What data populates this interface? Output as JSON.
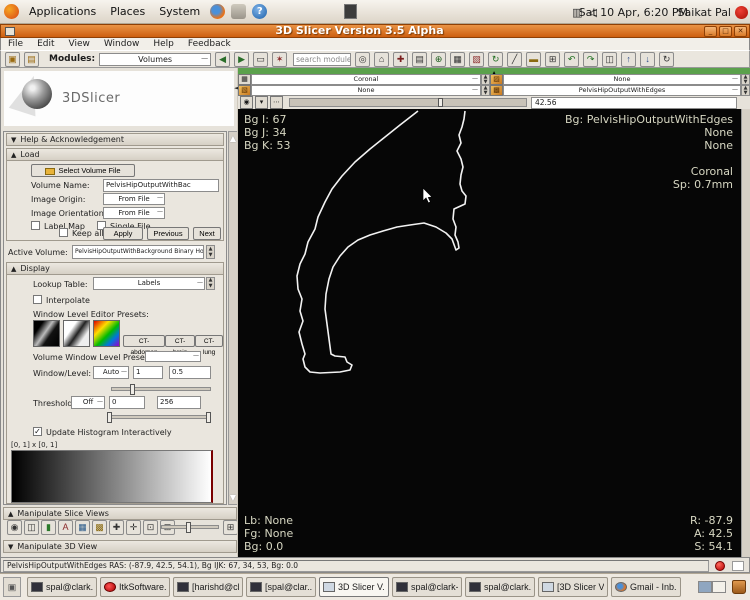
{
  "desktop": {
    "menus": [
      {
        "label": "Applications"
      },
      {
        "label": "Places"
      },
      {
        "label": "System"
      }
    ],
    "clock": "Sat 10 Apr,  6:20 PM",
    "user": "Saikat Pal"
  },
  "window": {
    "title": "3D Slicer Version 3.5 Alpha",
    "minimize": "_",
    "maximize": "□",
    "close": "✕"
  },
  "menubar": {
    "items": [
      {
        "label": "File"
      },
      {
        "label": "Edit"
      },
      {
        "label": "View"
      },
      {
        "label": "Window"
      },
      {
        "label": "Help"
      },
      {
        "label": "Feedback"
      }
    ]
  },
  "toolbar": {
    "load_scene_glyph": "▣",
    "save_scene_glyph": "▤",
    "modules_label": "Modules:",
    "module_value": "Volumes",
    "prev_glyph": "◀",
    "next_glyph": "▶",
    "layout_glyph": "▭",
    "extensions_glyph": "✶",
    "search_value": "search modules",
    "icons": [
      {
        "name": "find-modules-icon",
        "glyph": "◎"
      },
      {
        "name": "home-icon",
        "glyph": "⌂"
      },
      {
        "name": "fiducials-icon",
        "glyph": "✚",
        "color": "#7a1f1f"
      },
      {
        "name": "data-icon",
        "glyph": "▤"
      },
      {
        "name": "crosshair-icon",
        "glyph": "⊕",
        "color": "#1f5e1f"
      },
      {
        "name": "layers-icon",
        "glyph": "▦"
      },
      {
        "name": "editor-icon",
        "glyph": "▧",
        "color": "#8a2a2a"
      },
      {
        "name": "transforms-icon",
        "glyph": "↻",
        "color": "#1f6e1f"
      },
      {
        "name": "slice-tool-icon",
        "glyph": "╱"
      },
      {
        "name": "measurements-icon",
        "glyph": "▬",
        "color": "#8a6a10"
      },
      {
        "name": "colors-icon",
        "glyph": "⊞"
      },
      {
        "name": "undo-icon",
        "glyph": "↶",
        "color": "#1f6e1f"
      },
      {
        "name": "redo-icon",
        "glyph": "↷",
        "color": "#1f6e1f"
      },
      {
        "name": "scene-snapshot-icon",
        "glyph": "◫"
      },
      {
        "name": "pin-up-icon",
        "glyph": "↑",
        "color": "#2a4a8a"
      },
      {
        "name": "pin-down-icon",
        "glyph": "↓",
        "color": "#2a4a8a"
      },
      {
        "name": "screen-capture-icon",
        "glyph": "↻"
      }
    ]
  },
  "left_panel": {
    "logo_text": "3DSlicer",
    "help_header": "Help & Acknowledgement",
    "load": {
      "header": "Load",
      "select_button": "Select Volume File",
      "volume_name_label": "Volume Name:",
      "volume_name_value": "PelvisHipOutputWithBac",
      "image_origin_label": "Image Origin:",
      "image_origin_value": "From File",
      "image_orientation_label": "Image Orientation:",
      "image_orientation_value": "From File",
      "label_map": "Label Map",
      "single_file": "Single File",
      "keep_all": "Keep all",
      "apply": "Apply",
      "previous": "Previous",
      "next": "Next"
    },
    "active_volume_label": "Active Volume:",
    "active_volume_value": "PelvisHipOutputWithBackground Binary HoleFilled",
    "display": {
      "header": "Display",
      "lookup_table_label": "Lookup Table:",
      "lookup_table_value": "Labels",
      "interpolate": "Interpolate",
      "wl_presets_label": "Window Level Editor Presets:",
      "preset_buttons": [
        {
          "label": "CT-abdomen"
        },
        {
          "label": "CT-brain"
        },
        {
          "label": "CT-lung"
        }
      ],
      "volume_wl_presets_label": "Volume Window Level Presets:",
      "window_level_label": "Window/Level:",
      "window_level_mode": "Auto",
      "window_value": "1",
      "level_value": "0.5",
      "threshold_label": "Threshold:",
      "threshold_mode": "Off",
      "threshold_low": "0",
      "threshold_high": "256",
      "update_histogram": "Update Histogram Interactively",
      "histogram_range": "[0, 1] x [0, 1]"
    },
    "slice_views_header": "Manipulate Slice Views",
    "slice_view_icons": [
      {
        "name": "slice-visibility-icon",
        "glyph": "◉"
      },
      {
        "name": "fit-to-window-icon",
        "glyph": "◫"
      },
      {
        "name": "label-opacity-icon",
        "glyph": "▮",
        "color": "#2a7a2a"
      },
      {
        "name": "annotation-icon",
        "glyph": "A",
        "color": "#8a2a2a"
      },
      {
        "name": "compositing-icon",
        "glyph": "▦",
        "color": "#2a5a8a"
      },
      {
        "name": "label-outline-icon",
        "glyph": "▩",
        "color": "#8a6a10"
      },
      {
        "name": "crosshair-mode-icon",
        "glyph": "✚"
      },
      {
        "name": "pan-icon",
        "glyph": "✛"
      },
      {
        "name": "lightbox-icon",
        "glyph": "⊡"
      },
      {
        "name": "screenshot-icon",
        "glyph": "⊞"
      }
    ],
    "view_3d_header": "Manipulate 3D View"
  },
  "viewport": {
    "controls": {
      "row1_left": "Coronal",
      "row1_right": "None",
      "row2_left": "None",
      "row2_right": "PelvisHipOutputWithEdges",
      "offset_value": "42.56"
    },
    "overlays": {
      "top_left": [
        {
          "text": "Bg I: 67"
        },
        {
          "text": "Bg J: 34"
        },
        {
          "text": "Bg K: 53"
        }
      ],
      "top_right": [
        {
          "text": "Bg: PelvisHipOutputWithEdges"
        },
        {
          "text": "None"
        },
        {
          "text": "None"
        }
      ],
      "orientation": "Coronal",
      "spacing": "Sp: 0.7mm",
      "bottom_left": [
        {
          "text": "Lb: None"
        },
        {
          "text": "Fg: None"
        },
        {
          "text": "Bg: 0.0"
        }
      ],
      "bottom_right": [
        {
          "text": "R: -87.9"
        },
        {
          "text": "A: 42.5"
        },
        {
          "text": "S: 54.1"
        }
      ]
    }
  },
  "statusbar": {
    "text": "PelvisHipOutputWithEdges RAS: (-87.9, 42.5, 54.1),  Bg IJK: 67, 34, 53,  Bg: 0.0"
  },
  "taskbar": {
    "items": [
      {
        "name": "task-spal-clark-1",
        "label": "spal@clark...",
        "icon": "terminal"
      },
      {
        "name": "task-itksoftware",
        "label": "ItkSoftware...",
        "icon": "red"
      },
      {
        "name": "task-harishd",
        "label": "[harishd@cl...",
        "icon": "terminal"
      },
      {
        "name": "task-spal-clark-2",
        "label": "[spal@clar...",
        "icon": "terminal"
      },
      {
        "name": "task-3d-slicer",
        "label": "3D Slicer V...",
        "icon": "app",
        "active": true
      },
      {
        "name": "task-spal-clark-3",
        "label": "spal@clark-...",
        "icon": "terminal"
      },
      {
        "name": "task-spal-clark-4",
        "label": "spal@clark...",
        "icon": "terminal"
      },
      {
        "name": "task-3d-slicer-2",
        "label": "[3D Slicer V...",
        "icon": "app"
      },
      {
        "name": "task-gmail",
        "label": "Gmail - Inb...",
        "icon": "firefox"
      }
    ]
  },
  "colors": {
    "accent_green": "#5ba14c",
    "titlebar_orange": "#cd5f10",
    "overlay_text": "#d7d7c2"
  }
}
